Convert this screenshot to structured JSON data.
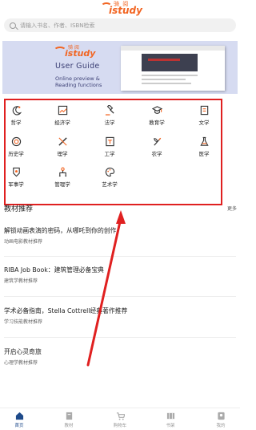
{
  "header": {
    "logo_top": "骑 阅",
    "logo_main": "istudy",
    "search_placeholder": "请输入书名、作者、ISBN检索"
  },
  "banner": {
    "logo_top": "骑 阅",
    "logo_main": "istudy",
    "title": "User  Guide",
    "subtitle_1": "Online preview &",
    "subtitle_2": "Reading functions"
  },
  "categories": [
    {
      "label": "哲学",
      "icon": "moon-icon"
    },
    {
      "label": "经济学",
      "icon": "chart-icon"
    },
    {
      "label": "法学",
      "icon": "gavel-icon"
    },
    {
      "label": "教育学",
      "icon": "graduation-cap-icon"
    },
    {
      "label": "文学",
      "icon": "book-icon"
    },
    {
      "label": "历史学",
      "icon": "history-icon"
    },
    {
      "label": "理学",
      "icon": "ruler-pen-icon"
    },
    {
      "label": "工学",
      "icon": "engineering-icon"
    },
    {
      "label": "农学",
      "icon": "sprout-icon"
    },
    {
      "label": "医学",
      "icon": "flask-icon"
    },
    {
      "label": "军事学",
      "icon": "military-badge-icon"
    },
    {
      "label": "管理学",
      "icon": "management-icon"
    },
    {
      "label": "艺术学",
      "icon": "palette-icon"
    }
  ],
  "section": {
    "title": "教材推荐",
    "more": "更多"
  },
  "recommendations": [
    {
      "title": "解锁动画表演的密码，从哪吒到你的创作",
      "subtitle": "动画电影教材推荐"
    },
    {
      "title": "RIBA Job Book：建筑管理必备宝典",
      "subtitle": "建筑学教材推荐"
    },
    {
      "title": "学术必备指南，Stella Cottrell经典著作推荐",
      "subtitle": "学习技能教材推荐"
    },
    {
      "title": "开启心灵奇旅",
      "subtitle": "心理学教材推荐"
    }
  ],
  "tabs": [
    {
      "label": "首页",
      "icon": "home-icon",
      "active": true
    },
    {
      "label": "教材",
      "icon": "textbook-icon",
      "active": false
    },
    {
      "label": "购物车",
      "icon": "cart-icon",
      "active": false
    },
    {
      "label": "书架",
      "icon": "bookshelf-icon",
      "active": false
    },
    {
      "label": "我的",
      "icon": "profile-icon",
      "active": false
    }
  ],
  "colors": {
    "brand": "#f26522",
    "highlight_box": "#e02020",
    "arrow": "#e02020",
    "tab_active": "#1e4a8a",
    "banner_bg": "#d6dbf1"
  }
}
